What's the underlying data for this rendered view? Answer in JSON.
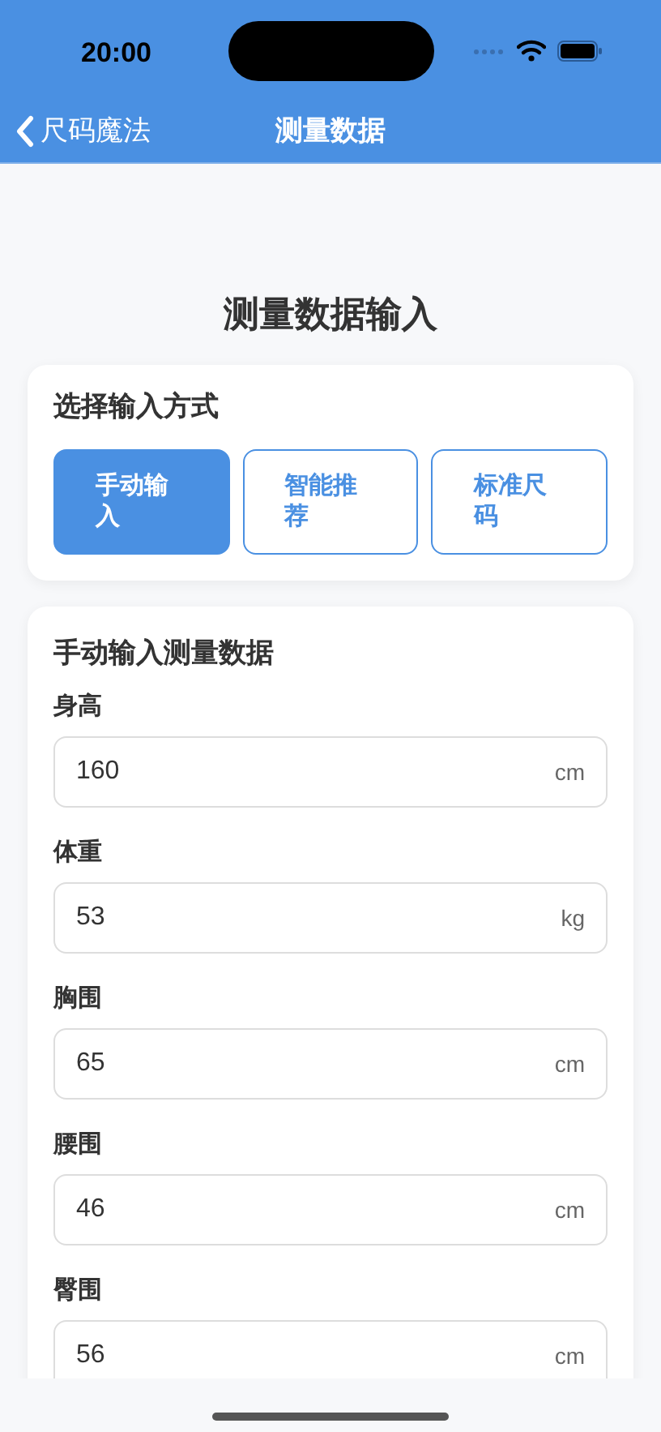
{
  "status_bar": {
    "time": "20:00"
  },
  "nav": {
    "back_label": "尺码魔法",
    "title": "测量数据"
  },
  "page_title": "测量数据输入",
  "method_card": {
    "title": "选择输入方式",
    "options": [
      {
        "label": "手动输入",
        "selected": true
      },
      {
        "label": "智能推荐",
        "selected": false
      },
      {
        "label": "标准尺码",
        "selected": false
      }
    ]
  },
  "manual_card": {
    "title": "手动输入测量数据",
    "fields": [
      {
        "label": "身高",
        "value": "160",
        "unit": "cm"
      },
      {
        "label": "体重",
        "value": "53",
        "unit": "kg"
      },
      {
        "label": "胸围",
        "value": "65",
        "unit": "cm"
      },
      {
        "label": "腰围",
        "value": "46",
        "unit": "cm"
      },
      {
        "label": "臀围",
        "value": "56",
        "unit": "cm"
      }
    ]
  }
}
